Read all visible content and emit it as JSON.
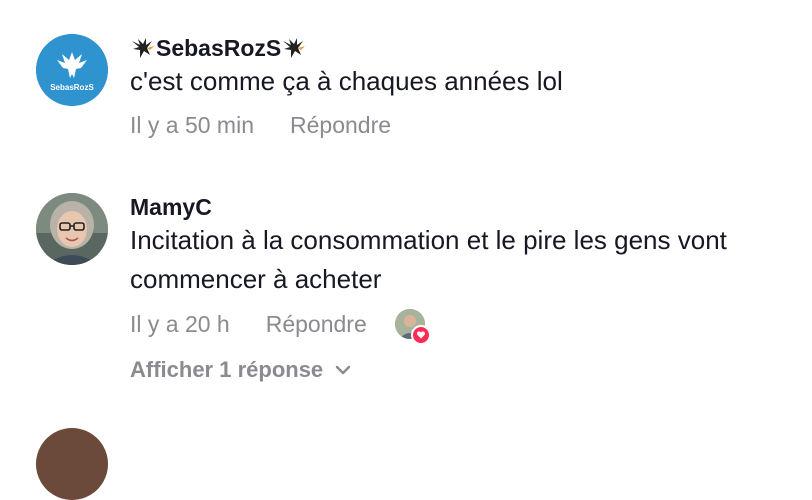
{
  "comments": [
    {
      "username": "SebasRozS",
      "avatar_label": "SebasRozS",
      "avatar_color": "#2f93cf",
      "text": "c'est comme ça à chaques années lol",
      "time": "Il y a 50 min",
      "reply_label": "Répondre",
      "username_icons": [
        "eagle-icon",
        "eagle-icon"
      ]
    },
    {
      "username": "MamyC",
      "text": "Incitation à la consommation et le pire les gens vont commencer à acheter",
      "time": "Il y a 20 h",
      "reply_label": "Répondre",
      "creator_liked": true,
      "view_replies_label": "Afficher 1 réponse"
    }
  ],
  "colors": {
    "primary_text": "#161823",
    "secondary_text": "#8a8b91",
    "like_badge": "#fe2c55"
  }
}
